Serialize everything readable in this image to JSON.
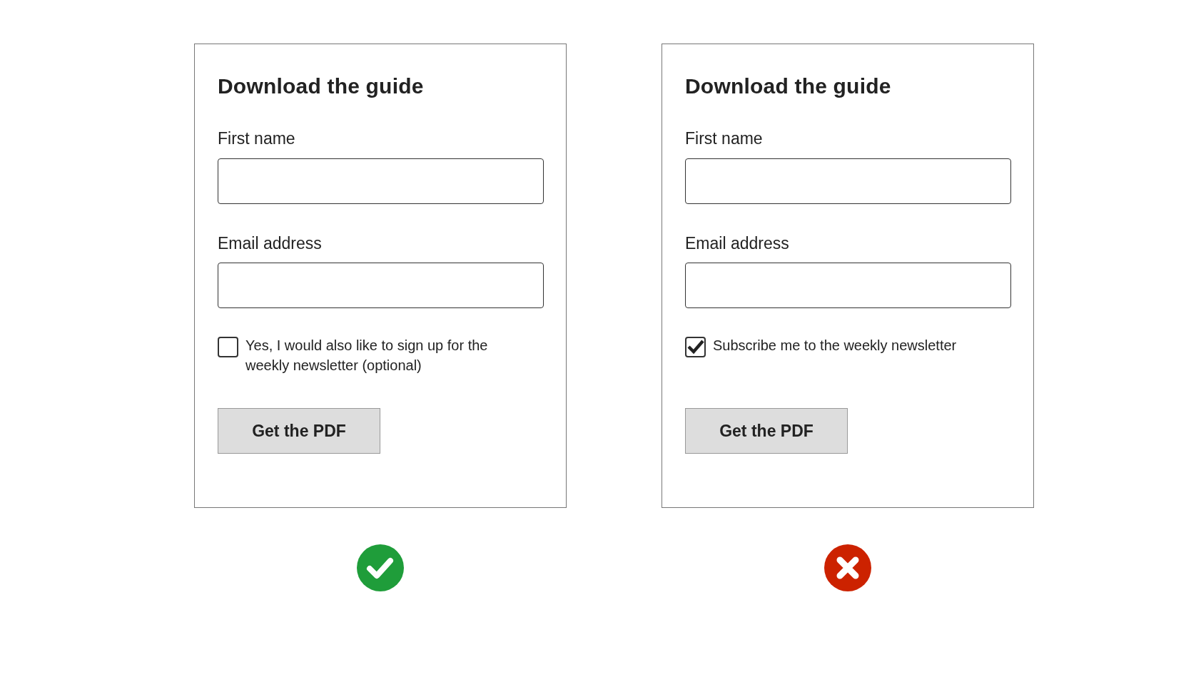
{
  "forms": [
    {
      "title": "Download the guide",
      "fields": [
        {
          "label": "First name"
        },
        {
          "label": "Email address"
        }
      ],
      "checkbox": {
        "label": "Yes, I would also like to sign up for the weekly newsletter (optional)",
        "checked": false
      },
      "button": "Get the PDF",
      "kind": "good"
    },
    {
      "title": "Download the guide",
      "fields": [
        {
          "label": "First name"
        },
        {
          "label": "Email address"
        }
      ],
      "checkbox": {
        "label": "Subscribe me to the weekly newsletter",
        "checked": true
      },
      "button": "Get the PDF",
      "kind": "bad"
    }
  ]
}
